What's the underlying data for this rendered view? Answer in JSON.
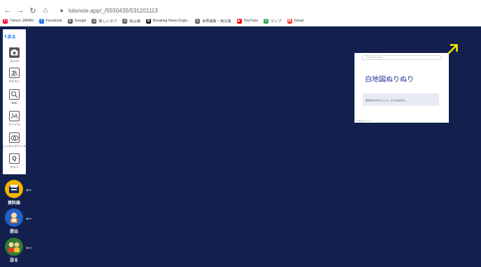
{
  "browser": {
    "url": "lolonote.app/_/5550435/531201113",
    "bookmarks": [
      {
        "label": "Yahoo! JAPAN",
        "icon": "yahoo-icon",
        "color": "#ff0033",
        "glyph": "Y!"
      },
      {
        "label": "Facebook",
        "icon": "facebook-icon",
        "color": "#1877f2",
        "glyph": "f"
      },
      {
        "label": "Google",
        "icon": "google-icon",
        "color": "#5f6368",
        "glyph": "G"
      },
      {
        "label": "新しいタブ",
        "icon": "globe-icon",
        "color": "#5f6368",
        "glyph": "◎"
      },
      {
        "label": "私以美",
        "icon": "globe-icon",
        "color": "#5f6368",
        "glyph": "◎"
      },
      {
        "label": "Breaking News Engli...",
        "icon": "breaking-news-icon",
        "color": "#222222",
        "glyph": "B"
      },
      {
        "label": "世界最新・英文掲",
        "icon": "globe-icon",
        "color": "#5f6368",
        "glyph": "◎"
      },
      {
        "label": "YouTube",
        "icon": "youtube-icon",
        "color": "#ff0000",
        "glyph": "▶"
      },
      {
        "label": "マップ",
        "icon": "maps-icon",
        "color": "#34a853",
        "glyph": "⚲"
      },
      {
        "label": "Gmail",
        "icon": "gmail-icon",
        "color": "#ea4335",
        "glyph": "M"
      }
    ]
  },
  "toolbar": {
    "back_label": "戻る",
    "tools": [
      {
        "label": "カメラ",
        "icon": "camera-icon"
      },
      {
        "label": "テキスト",
        "icon": "text-icon"
      },
      {
        "label": "Web",
        "icon": "web-icon"
      },
      {
        "label": "ファイル",
        "icon": "file-icon"
      },
      {
        "label": "シンキングツール",
        "icon": "thinking-tool-icon"
      },
      {
        "label": "テスト",
        "icon": "test-icon"
      }
    ]
  },
  "actions": [
    {
      "label": "資料箱",
      "icon": "materials-box-icon",
      "color": "#f2b400"
    },
    {
      "label": "提出",
      "icon": "submit-icon",
      "color": "#1f63c6"
    },
    {
      "label": "送る",
      "icon": "send-icon",
      "color": "#2e7d32"
    }
  ],
  "card": {
    "search_placeholder": "Search Wikimedia",
    "title": "白地図ぬりぬり",
    "note": "都道府県を色分けしよう。まずは地方別に。",
    "footer": "© ロイロノート"
  },
  "colors": {
    "background": "#13204e",
    "expand_arrow": "#f5e600",
    "title_text": "#24309c"
  }
}
